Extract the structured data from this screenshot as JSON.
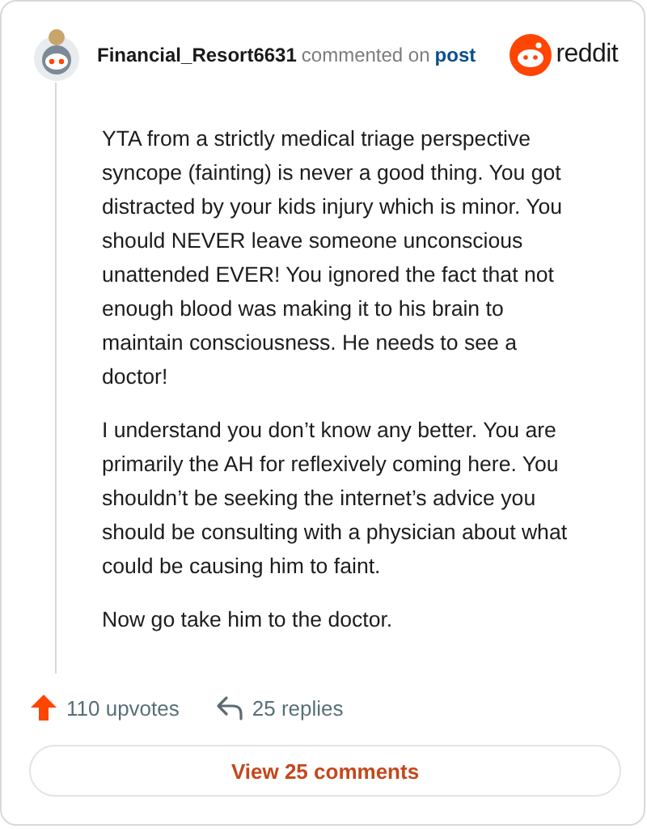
{
  "comment": {
    "author": "Financial_Resort6631",
    "action": "commented on",
    "target": "post",
    "brand": "reddit",
    "paragraphs": [
      "YTA from a strictly medical triage perspective syncope (fainting) is never a good thing. You got distracted by your kids injury which is minor. You should NEVER leave someone unconscious unattended EVER! You ignored the fact that not enough blood was making it to his brain to maintain consciousness. He needs to see a doctor!",
      "I understand you don’t know any better. You are primarily the AH for reflexively coming here. You shouldn’t be seeking the internet’s advice you should be consulting with a physician about what could be causing him to faint.",
      "Now go take him to the doctor."
    ],
    "upvotes": "110 upvotes",
    "replies": "25 replies",
    "view_button": "View 25 comments"
  }
}
